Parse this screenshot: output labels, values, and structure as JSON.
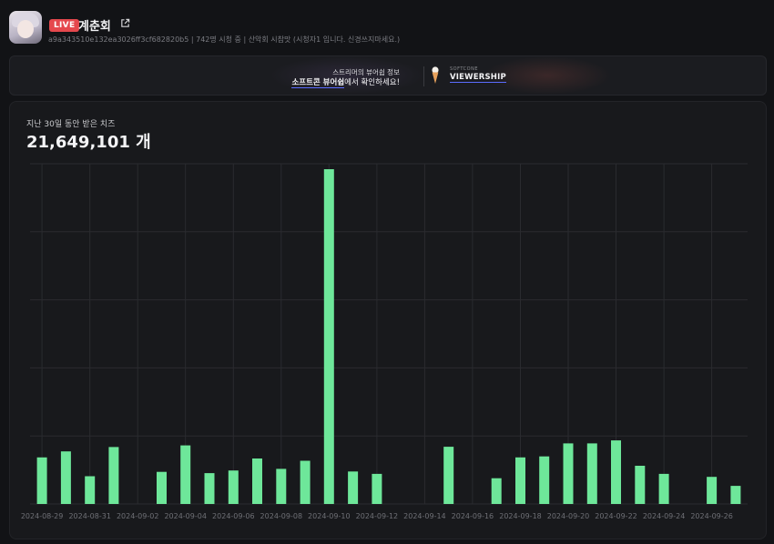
{
  "header": {
    "live_label": "LIVE",
    "streamer_name": "계춘회",
    "meta_text": "a9a343510e132ea3026ff3cf682820b5 | 742명 시청 중 | 산악회 시참맛 (시청자1 입니다. 신경쓰지마세요.)",
    "avatar_icon": "avatar-image",
    "external_icon": "external-link-icon"
  },
  "banner": {
    "line1": "스트리머의 뷰어쉽 정보",
    "line2_highlight": "소프트콘 뷰어쉽",
    "line2_rest": "에서 확인하세요!",
    "brand_small": "SOFTCONE",
    "brand_name": "VIEWERSHIP",
    "brand_icon": "ice-cream-cone-icon",
    "accent_color": "#5b6cff"
  },
  "stats": {
    "label": "지난 30일 동안 받은 치즈",
    "total": "21,649,101 개"
  },
  "chart_data": {
    "type": "bar",
    "title": "",
    "xlabel": "",
    "ylabel": "",
    "grid": true,
    "bar_color": "#6ee79a",
    "ylim": [
      0,
      10
    ],
    "tick_labels": [
      "2024-08-29",
      "2024-08-31",
      "2024-09-02",
      "2024-09-04",
      "2024-09-06",
      "2024-09-08",
      "2024-09-10",
      "2024-09-12",
      "2024-09-14",
      "2024-09-16",
      "2024-09-18",
      "2024-09-20",
      "2024-09-22",
      "2024-09-24",
      "2024-09-26"
    ],
    "categories": [
      "2024-08-29",
      "2024-08-30",
      "2024-08-31",
      "2024-09-01",
      "2024-09-02",
      "2024-09-03",
      "2024-09-04",
      "2024-09-05",
      "2024-09-06",
      "2024-09-07",
      "2024-09-08",
      "2024-09-09",
      "2024-09-10",
      "2024-09-11",
      "2024-09-12",
      "2024-09-13",
      "2024-09-14",
      "2024-09-15",
      "2024-09-16",
      "2024-09-17",
      "2024-09-18",
      "2024-09-19",
      "2024-09-20",
      "2024-09-21",
      "2024-09-22",
      "2024-09-23",
      "2024-09-24",
      "2024-09-25",
      "2024-09-26",
      "2024-09-27"
    ],
    "values": [
      1.39,
      1.57,
      0.83,
      1.7,
      0,
      0.96,
      1.75,
      0.92,
      1.0,
      1.36,
      1.05,
      1.29,
      10.0,
      0.97,
      0.9,
      0,
      0,
      1.71,
      0,
      0.77,
      1.39,
      1.42,
      1.81,
      1.81,
      1.9,
      1.14,
      0.9,
      0,
      0.81,
      0.54
    ]
  }
}
